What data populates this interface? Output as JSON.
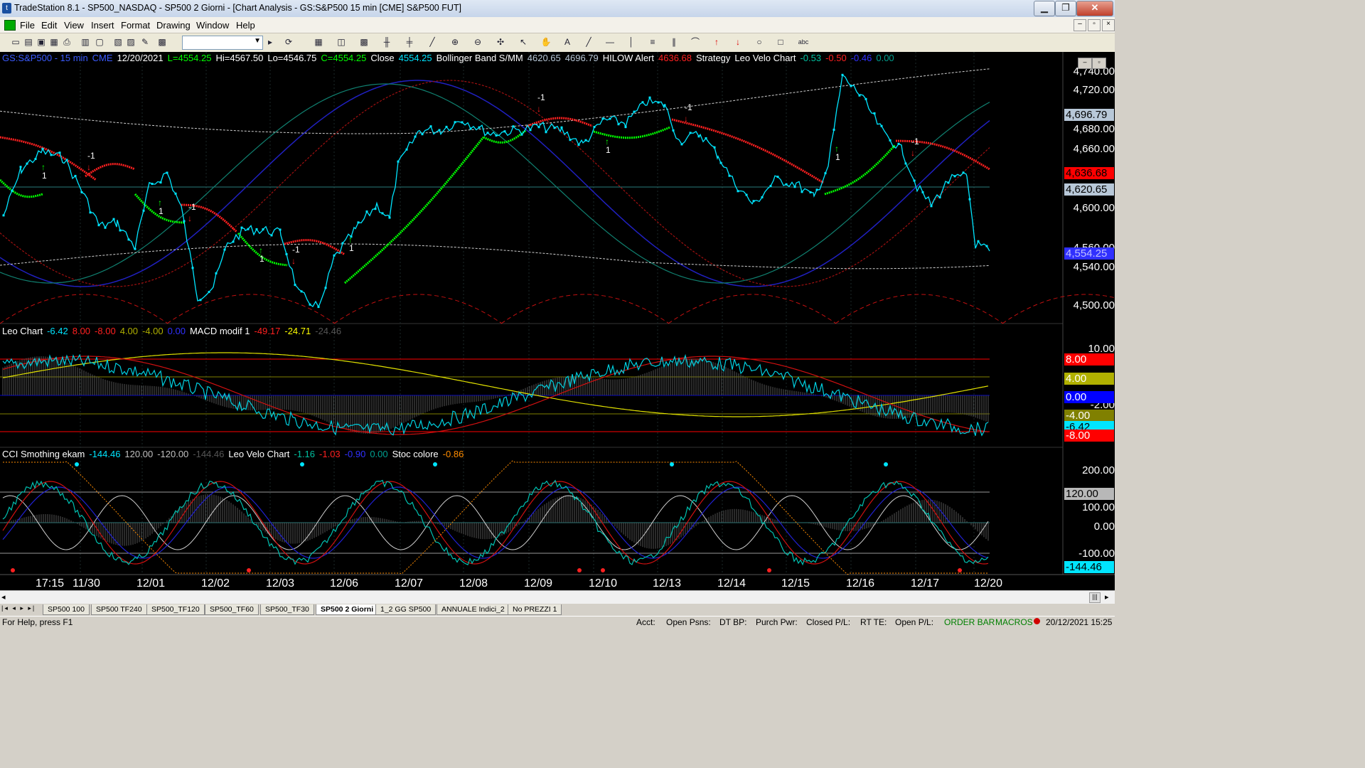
{
  "window": {
    "title": "TradeStation 8.1 - SP500_NASDAQ - SP500 2 Giorni - [Chart Analysis - GS:S&P500  15 min  [CME] S&P500 FUT]",
    "min": "▁",
    "max": "❐",
    "close": "✕"
  },
  "menu": [
    "File",
    "Edit",
    "View",
    "Insert",
    "Format",
    "Drawing",
    "Window",
    "Help"
  ],
  "toolbar": {
    "symbol_value": ""
  },
  "price_header": [
    {
      "t": "GS:S&P500 - 15 min",
      "c": "#3b5bff"
    },
    {
      "t": "CME",
      "c": "#3b5bff"
    },
    {
      "t": "12/20/2021",
      "c": "#ffffff"
    },
    {
      "t": "L=4554.25",
      "c": "#00ff00"
    },
    {
      "t": "Hi=4567.50",
      "c": "#ffffff"
    },
    {
      "t": "Lo=4546.75",
      "c": "#ffffff"
    },
    {
      "t": "C=4554.25",
      "c": "#00ff00"
    },
    {
      "t": "Close",
      "c": "#ffffff"
    },
    {
      "t": "4554.25",
      "c": "#00e5ff"
    },
    {
      "t": "Bollinger Band S/MM",
      "c": "#ffffff"
    },
    {
      "t": "4620.65",
      "c": "#b8c8d8"
    },
    {
      "t": "4696.79",
      "c": "#b8c8d8"
    },
    {
      "t": "HILOW Alert",
      "c": "#ffffff"
    },
    {
      "t": "4636.68",
      "c": "#ff2020"
    },
    {
      "t": "Strategy",
      "c": "#ffffff"
    },
    {
      "t": "Leo Velo Chart",
      "c": "#ffffff"
    },
    {
      "t": "-0.53",
      "c": "#00c0a0"
    },
    {
      "t": "-0.50",
      "c": "#ff2020"
    },
    {
      "t": "-0.46",
      "c": "#3030ff"
    },
    {
      "t": "0.00",
      "c": "#00a090"
    }
  ],
  "leo_header": [
    {
      "t": "Leo Chart",
      "c": "#ffffff"
    },
    {
      "t": "-6.42",
      "c": "#00e5ff"
    },
    {
      "t": "8.00",
      "c": "#ff2020"
    },
    {
      "t": "-8.00",
      "c": "#ff2020"
    },
    {
      "t": "4.00",
      "c": "#b0b000"
    },
    {
      "t": "-4.00",
      "c": "#b0b000"
    },
    {
      "t": "0.00",
      "c": "#3030ff"
    },
    {
      "t": "MACD modif 1",
      "c": "#ffffff"
    },
    {
      "t": "-49.17",
      "c": "#ff2020"
    },
    {
      "t": "-24.71",
      "c": "#ffff00"
    },
    {
      "t": "-24.46",
      "c": "#555555"
    }
  ],
  "cci_header": [
    {
      "t": "CCI Smothing ekam",
      "c": "#ffffff"
    },
    {
      "t": "-144.46",
      "c": "#00e5ff"
    },
    {
      "t": "120.00",
      "c": "#c0c0c0"
    },
    {
      "t": "-120.00",
      "c": "#c0c0c0"
    },
    {
      "t": "-144.46",
      "c": "#555555"
    },
    {
      "t": "Leo Velo Chart",
      "c": "#ffffff"
    },
    {
      "t": "-1.16",
      "c": "#00c0a0"
    },
    {
      "t": "-1.03",
      "c": "#ff2020"
    },
    {
      "t": "-0.90",
      "c": "#3030ff"
    },
    {
      "t": "0.00",
      "c": "#00a090"
    },
    {
      "t": "Stoc colore",
      "c": "#ffffff"
    },
    {
      "t": "-0.86",
      "c": "#ff8c00"
    }
  ],
  "price_axis": [
    "4,740.00",
    "4,720.00",
    "4,680.00",
    "4,660.00",
    "4,600.00",
    "4,560.00",
    "4,540.00",
    "4,500.00"
  ],
  "price_tags": [
    {
      "t": "4,696.79",
      "bg": "#b8c8d8",
      "fg": "#000000"
    },
    {
      "t": "4,636.68",
      "bg": "#ff0000",
      "fg": "#000000"
    },
    {
      "t": "4,620.65",
      "bg": "#b8c8d8",
      "fg": "#000000"
    },
    {
      "t": "4,554.25",
      "bg": "#3030ff",
      "fg": "#c0c0ff"
    }
  ],
  "leo_axis": [
    "10.00",
    "-2.00"
  ],
  "leo_tags": [
    {
      "t": "8.00",
      "bg": "#ff0000",
      "fg": "#ffffff"
    },
    {
      "t": "4.00",
      "bg": "#b0b000",
      "fg": "#ffffff"
    },
    {
      "t": "0.00",
      "bg": "#0000ff",
      "fg": "#ffffff"
    },
    {
      "t": "-4.00",
      "bg": "#808000",
      "fg": "#ffffff"
    },
    {
      "t": "-6.42",
      "bg": "#00e5ff",
      "fg": "#000000"
    },
    {
      "t": "-8.00",
      "bg": "#ff0000",
      "fg": "#ffffff"
    }
  ],
  "cci_axis": [
    "200.00",
    "100.00",
    "0.00",
    "-100.00"
  ],
  "cci_tags": [
    {
      "t": "120.00",
      "bg": "#b8b8b8",
      "fg": "#000000"
    },
    {
      "t": "-144.46",
      "bg": "#00e5ff",
      "fg": "#000000"
    }
  ],
  "time_axis": [
    "17:15",
    "11/30",
    "12/01",
    "12/02",
    "12/03",
    "12/06",
    "12/07",
    "12/08",
    "12/09",
    "12/10",
    "12/13",
    "12/14",
    "12/15",
    "12/16",
    "12/17",
    "12/20"
  ],
  "strategy_marks": [
    "1",
    "-1",
    "1",
    "-1",
    "1",
    "-1",
    "1",
    "-1",
    "1",
    "-1",
    "1",
    "-1"
  ],
  "workspace_tabs": [
    "SP500 100",
    "SP500 TF240",
    "SP500_TF120",
    "SP500_TF60",
    "SP500_TF30",
    "SP500 2 Giorni",
    "1_2 GG SP500",
    "ANNUALE Indici_2",
    "No PREZZI 1"
  ],
  "active_tab": "SP500 2 Giorni",
  "status": {
    "help": "For Help, press F1",
    "acct": "Acct:",
    "open_psns": "Open Psns:",
    "dt_bp": "DT BP:",
    "purch_pwr": "Purch Pwr:",
    "closed_pl": "Closed P/L:",
    "rt_te": "RT TE:",
    "open_pl": "Open P/L:",
    "order_bar": "ORDER BAR",
    "macros": "MACROS",
    "datetime": "20/12/2021 15:25"
  },
  "colors": {
    "bg": "#000000",
    "price": "#00e5ff",
    "sar_up": "#00ff00",
    "sar_down": "#ff2020",
    "band": "#c0c0c0"
  }
}
